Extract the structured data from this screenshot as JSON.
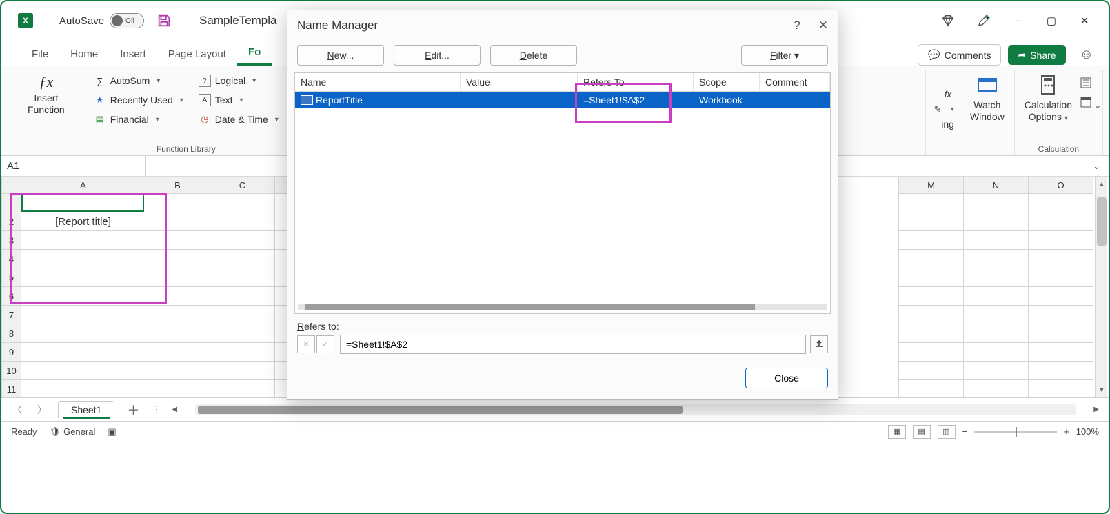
{
  "titlebar": {
    "autosave_label": "AutoSave",
    "autosave_off": "Off",
    "doc_title": "SampleTempla"
  },
  "tabs": {
    "file": "File",
    "home": "Home",
    "insert": "Insert",
    "page_layout": "Page Layout",
    "formulas_short": "Fo"
  },
  "rib_right": {
    "comments": "Comments",
    "share": "Share"
  },
  "ribbon": {
    "insert_function": "Insert\nFunction",
    "autosum": "AutoSum",
    "recently_used": "Recently Used",
    "financial": "Financial",
    "logical": "Logical",
    "text": "Text",
    "date_time": "Date & Time",
    "function_library": "Function Library",
    "watch_window": "Watch\nWindow",
    "calc_options": "Calculation\nOptions",
    "calculation": "Calculation",
    "trailing": "ing"
  },
  "name_box": "A1",
  "grid": {
    "cols": [
      "A",
      "B",
      "C"
    ],
    "cols_right": [
      "M",
      "N",
      "O"
    ],
    "rows": [
      "1",
      "2",
      "3",
      "4",
      "5",
      "6",
      "7",
      "8",
      "9",
      "10",
      "11"
    ],
    "a2_value": "[Report title]"
  },
  "sheet_tabs": {
    "sheet1": "Sheet1"
  },
  "status": {
    "ready": "Ready",
    "general": "General",
    "zoom": "100%"
  },
  "dialog": {
    "title": "Name Manager",
    "help": "?",
    "btn_new_pre": "N",
    "btn_new_post": "ew...",
    "btn_edit_pre": "E",
    "btn_edit_post": "dit...",
    "btn_delete_pre": "D",
    "btn_delete_post": "elete",
    "btn_filter_pre": "F",
    "btn_filter_post": "ilter",
    "headers": {
      "name": "Name",
      "value": "Value",
      "refers": "Refers To",
      "scope": "Scope",
      "comment": "Comment"
    },
    "row": {
      "name": "ReportTitle",
      "value": "",
      "refers": "=Sheet1!$A$2",
      "scope": "Workbook",
      "comment": ""
    },
    "refers_label_pre": "R",
    "refers_label_post": "efers to:",
    "refers_value": "=Sheet1!$A$2",
    "close": "Close"
  }
}
